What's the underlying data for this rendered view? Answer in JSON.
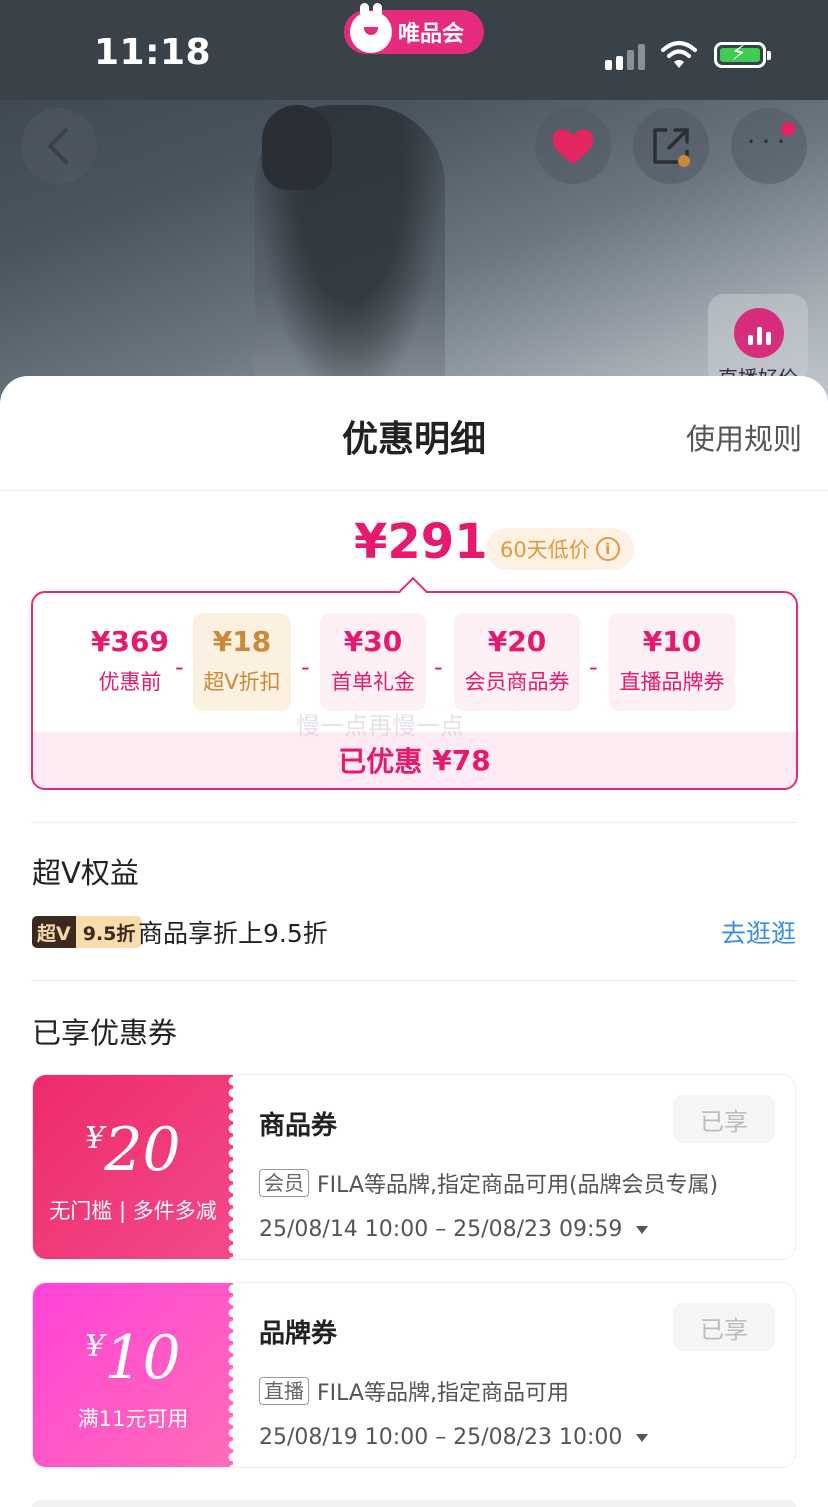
{
  "status_bar": {
    "time": "11:18",
    "app_badge": "唯品会"
  },
  "hero": {
    "live_chip_label": "直播好价"
  },
  "sheet": {
    "title": "优惠明细",
    "rules_link": "使用规则",
    "final_price": "¥291",
    "low_price_tag": "60天低价",
    "breakdown": [
      {
        "amount": "¥369",
        "label": "优惠前"
      },
      {
        "amount": "¥18",
        "label": "超V折扣"
      },
      {
        "amount": "¥30",
        "label": "首单礼金"
      },
      {
        "amount": "¥20",
        "label": "会员商品券"
      },
      {
        "amount": "¥10",
        "label": "直播品牌券"
      }
    ],
    "minus": "-",
    "saved_label": "已优惠",
    "saved_amount": "¥78",
    "watermark": "慢一点再慢一点"
  },
  "super_v": {
    "section_title": "超V权益",
    "badge_left": "超V",
    "badge_right": "9.5折",
    "text": "商品享折上9.5折",
    "link": "去逛逛"
  },
  "coupons": {
    "section_title": "已享优惠券",
    "items": [
      {
        "currency": "¥",
        "amount": "20",
        "condition": "无门槛 | 多件多减",
        "name": "商品券",
        "status": "已享",
        "tag": "会员",
        "desc": "FILA等品牌,指定商品可用(品牌会员专属)",
        "date": "25/08/14 10:00 – 25/08/23 09:59",
        "color": "#ee2a6a"
      },
      {
        "currency": "¥",
        "amount": "10",
        "condition": "满11元可用",
        "name": "品牌券",
        "status": "已享",
        "tag": "直播",
        "desc": "FILA等品牌,指定商品可用",
        "date": "25/08/19 10:00 – 25/08/23 10:00",
        "color": "#ff43d9"
      }
    ]
  },
  "icons": [
    "back-icon",
    "heart-icon",
    "share-icon",
    "more-icon",
    "live-chart-icon",
    "info-icon",
    "caret-down-icon"
  ],
  "colors": {
    "accent": "#e6196e",
    "gold": "#c98a3a",
    "link": "#3a8ee0"
  }
}
